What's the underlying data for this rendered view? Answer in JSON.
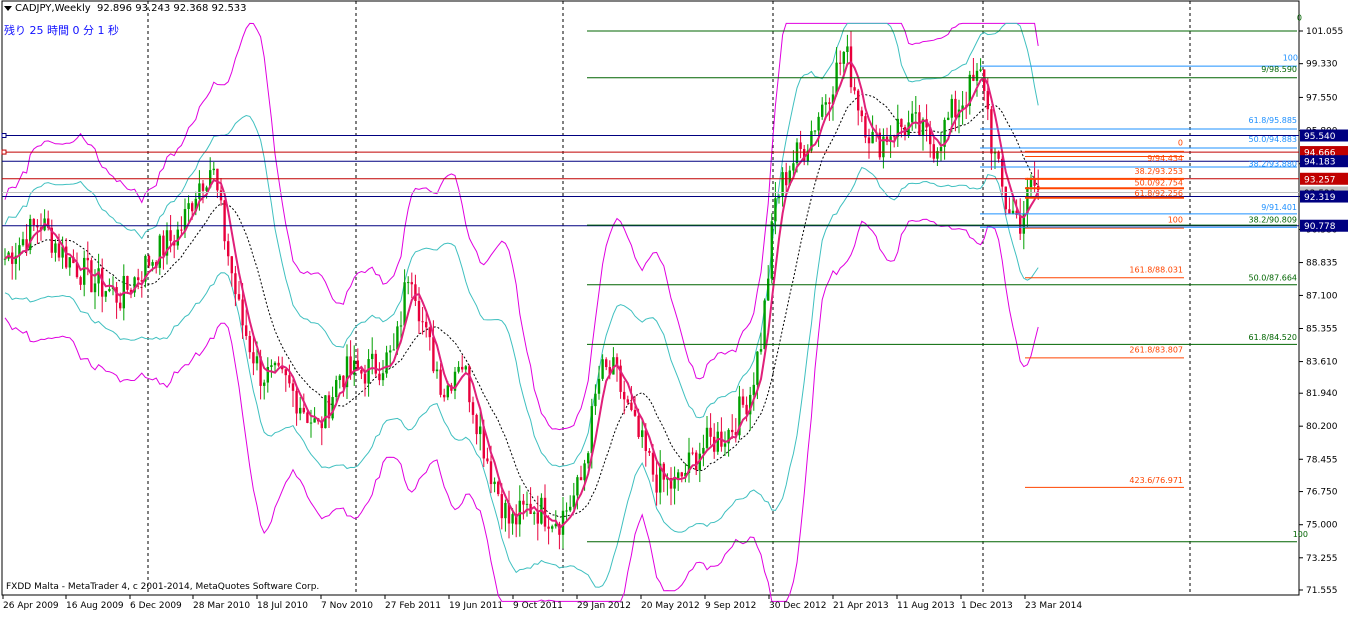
{
  "header": {
    "symbol": "CADJPY,Weekly",
    "ohlc": "92.896 93.243 92.368 92.533"
  },
  "timer_text": "残り 25 時間 0 分 1 秒",
  "copyright": "FXDD Malta - MetaTrader 4, c 2001-2014, MetaQuotes Software Corp.",
  "colors": {
    "bull": "#00a000",
    "bear": "#e8003c",
    "ma": "#e0207a",
    "bb_outer": "#e000e0",
    "bb_inner": "#40c0c0",
    "bb_mid": "#000000",
    "fib_green": "#006400",
    "fib_blue": "#1e90ff",
    "fib_red": "#ff4500",
    "line_navy": "#000080",
    "line_red": "#c00000"
  },
  "chart_data": {
    "type": "candlestick",
    "y_ticks": [
      "101.055",
      "99.330",
      "97.550",
      "95.800",
      "94.050",
      "92.325",
      "90.580",
      "88.835",
      "87.100",
      "85.355",
      "83.610",
      "81.940",
      "80.200",
      "78.455",
      "76.750",
      "75.000",
      "73.255",
      "71.555"
    ],
    "x_ticks": [
      "26 Apr 2009",
      "16 Aug 2009",
      "6 Dec 2009",
      "28 Mar 2010",
      "18 Jul 2010",
      "7 Nov 2010",
      "27 Feb 2011",
      "19 Jun 2011",
      "9 Oct 2011",
      "29 Jan 2012",
      "20 May 2012",
      "9 Sep 2012",
      "30 Dec 2012",
      "21 Apr 2013",
      "11 Aug 2013",
      "1 Dec 2013",
      "23 Mar 2014"
    ],
    "price_badges": [
      {
        "text": "95.540",
        "color": "#000080"
      },
      {
        "text": "94.666",
        "color": "#c00000"
      },
      {
        "text": "94.183",
        "color": "#000080"
      },
      {
        "text": "93.257",
        "color": "#c00000"
      },
      {
        "text": "92.533",
        "color": "#c0c0c0"
      },
      {
        "text": "92.319",
        "color": "#000080"
      },
      {
        "text": "90.778",
        "color": "#000080"
      }
    ],
    "fib_labels": [
      {
        "text": "0",
        "color": "#006400"
      },
      {
        "text": "100",
        "color": "#1e90ff"
      },
      {
        "text": "9/98.590",
        "color": "#006400"
      },
      {
        "text": "61.8/95.885",
        "color": "#1e90ff"
      },
      {
        "text": "0",
        "color": "#ff4500"
      },
      {
        "text": "50.0/94.883",
        "color": "#1e90ff"
      },
      {
        "text": "9/94.434",
        "color": "#ff4500"
      },
      {
        "text": "38.2/93.880",
        "color": "#1e90ff"
      },
      {
        "text": "38.2/93.253",
        "color": "#ff4500"
      },
      {
        "text": "50.0/92.754",
        "color": "#ff4500"
      },
      {
        "text": "61.8/92.256",
        "color": "#ff4500"
      },
      {
        "text": "9/91.401",
        "color": "#1e90ff"
      },
      {
        "text": "38.2/90.809",
        "color": "#006400"
      },
      {
        "text": "100",
        "color": "#ff4500"
      },
      {
        "text": "161.8/88.031",
        "color": "#ff4500"
      },
      {
        "text": "50.0/87.664",
        "color": "#006400"
      },
      {
        "text": "61.8/84.520",
        "color": "#006400"
      },
      {
        "text": "261.8/83.807",
        "color": "#ff4500"
      },
      {
        "text": "423.6/76.971",
        "color": "#ff4500"
      },
      {
        "text": "100",
        "color": "#006400"
      }
    ]
  }
}
